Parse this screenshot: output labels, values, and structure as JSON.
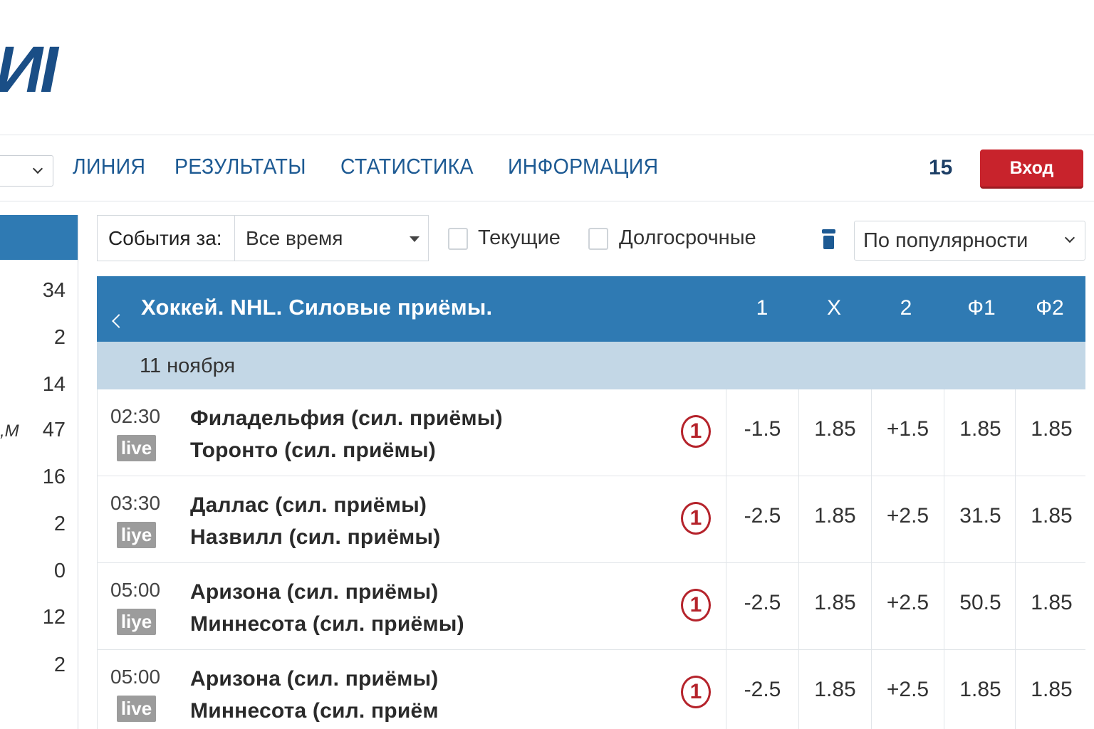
{
  "header": {
    "logo_text": "ИI",
    "nav": [
      "ЛИНИЯ",
      "РЕЗУЛЬТАТЫ",
      "СТАТИСТИКА",
      "ИНФОРМАЦИЯ"
    ],
    "count": "15",
    "login_label": "Вход"
  },
  "sidebar": {
    "rows": [
      {
        "label": "",
        "count": "34"
      },
      {
        "label": "",
        "count": "2"
      },
      {
        "label": "",
        "count": "14"
      },
      {
        "label": ",М",
        "count": "47"
      },
      {
        "label": "",
        "count": "16"
      },
      {
        "label": "",
        "count": "2"
      },
      {
        "label": "",
        "count": "0"
      },
      {
        "label": "",
        "count": "12"
      },
      {
        "label": "",
        "count": "2"
      }
    ]
  },
  "filters": {
    "events_label": "События за:",
    "period_value": "Все время",
    "current_label": "Текущие",
    "longterm_label": "Долгосрочные",
    "sort_value": "По популярности"
  },
  "table": {
    "title": "Хоккей. NHL. Силовые приёмы.",
    "columns": [
      "1",
      "X",
      "2",
      "Ф1",
      "Ф2"
    ],
    "date": "11 ноября",
    "events": [
      {
        "time": "02:30",
        "live": "live",
        "team1": "Филадельфия (сил. приёмы)",
        "team2": "Торонто (сил. приёмы)",
        "badge": "1",
        "odds": [
          "-1.5",
          "1.85",
          "+1.5",
          "1.85",
          "1.85"
        ]
      },
      {
        "time": "03:30",
        "live": "liye",
        "team1": "Даллас (сил. приёмы)",
        "team2": "Назвилл (сил. приёмы)",
        "badge": "1",
        "odds": [
          "-2.5",
          "1.85",
          "+2.5",
          "31.5",
          "1.85"
        ]
      },
      {
        "time": "05:00",
        "live": "liye",
        "team1": "Аризона (сил. приёмы)",
        "team2": "Миннесота (сил. приёмы)",
        "badge": "1",
        "odds": [
          "-2.5",
          "1.85",
          "+2.5",
          "50.5",
          "1.85"
        ]
      },
      {
        "time": "05:00",
        "live": "live",
        "team1": "Аризона (сил. приёмы)",
        "team2": "Миннесота (сил. приём",
        "badge": "1",
        "odds": [
          "-2.5",
          "1.85",
          "+2.5",
          "1.85",
          "1.85"
        ]
      }
    ]
  },
  "colors": {
    "brand_blue": "#2f7ab3",
    "nav_blue": "#1d5a93",
    "login_red": "#c8232c",
    "date_row": "#c3d7e6",
    "live_badge": "#9c9c9c"
  }
}
